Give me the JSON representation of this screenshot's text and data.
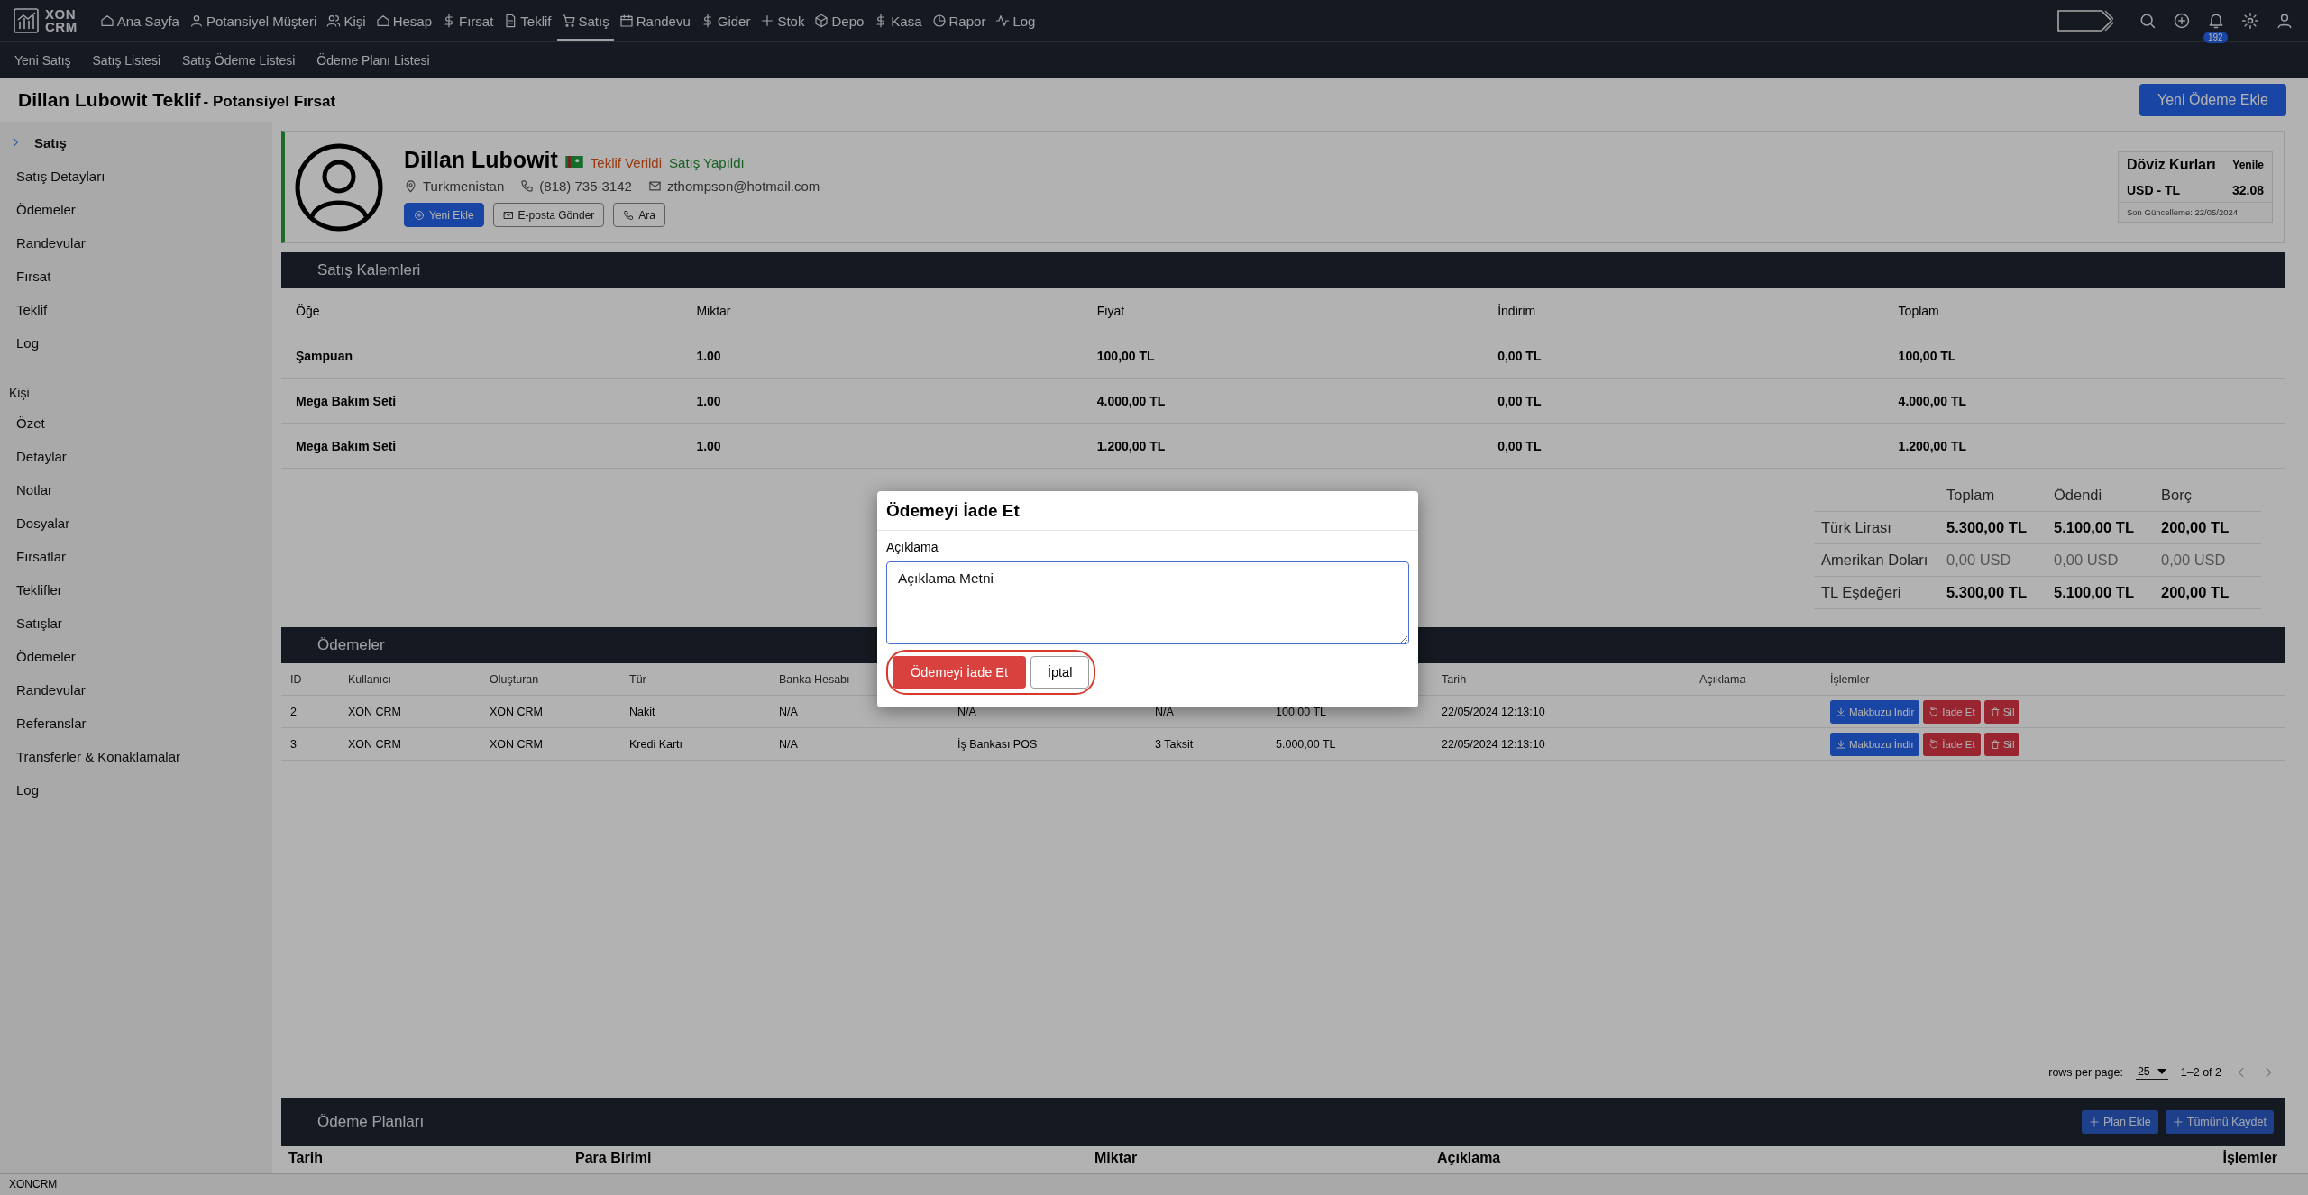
{
  "navbar": {
    "logo": [
      "XON",
      "CRM"
    ],
    "items": [
      {
        "label": "Ana Sayfa",
        "selected": false
      },
      {
        "label": "Potansiyel Müşteri",
        "selected": false
      },
      {
        "label": "Kişi",
        "selected": false
      },
      {
        "label": "Hesap",
        "selected": false
      },
      {
        "label": "Fırsat",
        "selected": false
      },
      {
        "label": "Teklif",
        "selected": false
      },
      {
        "label": "Satış",
        "selected": true
      },
      {
        "label": "Randevu",
        "selected": false
      },
      {
        "label": "Gider",
        "selected": false
      },
      {
        "label": "Stok",
        "selected": false
      },
      {
        "label": "Depo",
        "selected": false
      },
      {
        "label": "Kasa",
        "selected": false
      },
      {
        "label": "Rapor",
        "selected": false
      },
      {
        "label": "Log",
        "selected": false
      }
    ],
    "notification_count": "192"
  },
  "subnav": [
    "Yeni Satış",
    "Satış Listesi",
    "Satış Ödeme Listesi",
    "Ödeme Planı Listesi"
  ],
  "page_header": {
    "title": "Dillan Lubowit Teklif",
    "subtitle": "- Potansiyel Fırsat",
    "button": "Yeni Ödeme Ekle"
  },
  "sidebar": [
    {
      "title": "Satış",
      "expanded": true,
      "items": [
        "Satış Detayları",
        "Ödemeler",
        "Randevular",
        "Fırsat",
        "Teklif",
        "Log"
      ]
    },
    {
      "title": "Kişi",
      "items": [
        "Özet",
        "Detaylar",
        "Notlar",
        "Dosyalar",
        "Fırsatlar",
        "Teklifler",
        "Satışlar",
        "Ödemeler",
        "Randevular",
        "Referanslar",
        "Transferler & Konaklamalar",
        "Log"
      ]
    }
  ],
  "customer": {
    "name": "Dillan Lubowit",
    "tags": [
      {
        "label": "Teklif Verildi",
        "kind": "warning"
      },
      {
        "label": "Satış Yapıldı",
        "kind": "success"
      }
    ],
    "location": "Turkmenistan",
    "phone": "(818) 735-3142",
    "email": "zthompson@hotmail.com",
    "buttons": [
      {
        "label": "Yeni Ekle",
        "kind": "primary"
      },
      {
        "label": "E-posta Gönder",
        "kind": "outline"
      },
      {
        "label": "Ara",
        "kind": "outline"
      }
    ]
  },
  "exchange_rates": {
    "title": "Döviz Kurları",
    "refresh": "Yenile",
    "pair": "USD - TL",
    "rate": "32.08",
    "updated": "Son Güncelleme: 22/05/2024"
  },
  "sales_items": {
    "title": "Satış Kalemleri",
    "columns": [
      "Öğe",
      "Miktar",
      "Fiyat",
      "İndirim",
      "Toplam"
    ],
    "rows": [
      [
        "Şampuan",
        "1.00",
        "100,00 TL",
        "0,00 TL",
        "100,00 TL"
      ],
      [
        "Mega Bakım Seti",
        "1.00",
        "4.000,00 TL",
        "0,00 TL",
        "4.000,00 TL"
      ],
      [
        "Mega Bakım Seti",
        "1.00",
        "1.200,00 TL",
        "0,00 TL",
        "1.200,00 TL"
      ]
    ]
  },
  "summary": {
    "columns": [
      "Toplam",
      "Ödendi",
      "Borç"
    ],
    "rows": [
      {
        "label": "Türk Lirası",
        "values": [
          "5.300,00 TL",
          "5.100,00 TL",
          "200,00 TL"
        ],
        "muted": false
      },
      {
        "label": "Amerikan Doları",
        "values": [
          "0,00 USD",
          "0,00 USD",
          "0,00 USD"
        ],
        "muted": true
      },
      {
        "label": "TL Eşdeğeri",
        "values": [
          "5.300,00 TL",
          "5.100,00 TL",
          "200,00 TL"
        ],
        "muted": false
      }
    ]
  },
  "payments": {
    "title": "Ödemeler",
    "columns": [
      "ID",
      "Kullanıcı",
      "Oluşturan",
      "Tür",
      "Banka Hesabı",
      null,
      null,
      null,
      "Tarih",
      "Açıklama",
      "İşlemler"
    ],
    "rows": [
      {
        "cells": [
          "2",
          "XON CRM",
          "XON CRM",
          "Nakit",
          "N/A",
          "N/A",
          "N/A",
          "100,00 TL",
          "22/05/2024 12:13:10"
        ],
        "actions": [
          {
            "label": "Makbuzu İndir",
            "kind": "primary"
          },
          {
            "label": "İade Et",
            "kind": "danger"
          },
          {
            "label": "Sil",
            "kind": "danger"
          }
        ]
      },
      {
        "cells": [
          "3",
          "XON CRM",
          "XON CRM",
          "Kredi Kartı",
          "N/A",
          "İş Bankası POS",
          "3 Taksit",
          "5.000,00 TL",
          "22/05/2024 12:13:10"
        ],
        "actions": [
          {
            "label": "Makbuzu İndir",
            "kind": "primary"
          },
          {
            "label": "İade Et",
            "kind": "danger"
          },
          {
            "label": "Sil",
            "kind": "danger"
          }
        ]
      }
    ],
    "pagination": {
      "rows_label": "rows per page:",
      "rows_value": "25",
      "range": "1–2 of 2"
    }
  },
  "payment_plans": {
    "title": "Ödeme Planları",
    "buttons": [
      "Plan Ekle",
      "Tümünü Kaydet"
    ],
    "columns": [
      "Tarih",
      "Para Birimi",
      "Miktar",
      "Açıklama",
      "İşlemler"
    ]
  },
  "status_bar": "XONCRM",
  "modal": {
    "title": "Ödemeyi İade Et",
    "field_label": "Açıklama",
    "value": "Açıklama Metni",
    "confirm": "Ödemeyi İade Et",
    "cancel": "İptal",
    "highlighted": true
  }
}
